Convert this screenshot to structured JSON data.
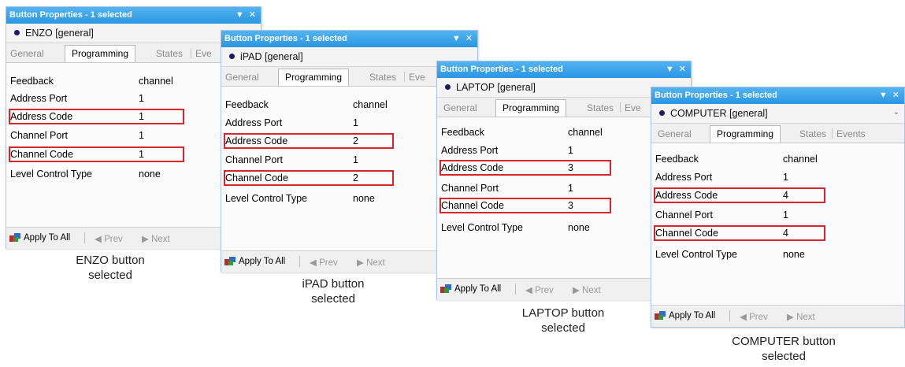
{
  "panels": [
    {
      "title": "Button Properties - 1 selected",
      "selected_label": "ENZO  [general]",
      "tabs": [
        "General",
        "Programming",
        "States",
        "Eve"
      ],
      "rows": [
        {
          "key": "Feedback",
          "value": "channel"
        },
        {
          "key": "Address Port",
          "value": "1"
        },
        {
          "key": "Address Code",
          "value": "1"
        },
        {
          "key": "Channel Port",
          "value": "1"
        },
        {
          "key": "Channel Code",
          "value": "1"
        },
        {
          "key": "Level Control Type",
          "value": "none"
        }
      ],
      "footer": {
        "apply": "Apply To All",
        "prev": "Prev",
        "next": "Next"
      },
      "caption": [
        "ENZO button",
        "selected"
      ]
    },
    {
      "title": "Button Properties - 1 selected",
      "selected_label": "iPAD  [general]",
      "tabs": [
        "General",
        "Programming",
        "States",
        "Eve"
      ],
      "rows": [
        {
          "key": "Feedback",
          "value": "channel"
        },
        {
          "key": "Address Port",
          "value": "1"
        },
        {
          "key": "Address Code",
          "value": "2"
        },
        {
          "key": "Channel Port",
          "value": "1"
        },
        {
          "key": "Channel Code",
          "value": "2"
        },
        {
          "key": "Level Control Type",
          "value": "none"
        }
      ],
      "footer": {
        "apply": "Apply To All",
        "prev": "Prev",
        "next": "Next"
      },
      "caption": [
        "iPAD button",
        "selected"
      ]
    },
    {
      "title": "Button Properties - 1 selected",
      "selected_label": "LAPTOP  [general]",
      "tabs": [
        "General",
        "Programming",
        "States",
        "Eve"
      ],
      "rows": [
        {
          "key": "Feedback",
          "value": "channel"
        },
        {
          "key": "Address Port",
          "value": "1"
        },
        {
          "key": "Address Code",
          "value": "3"
        },
        {
          "key": "Channel Port",
          "value": "1"
        },
        {
          "key": "Channel Code",
          "value": "3"
        },
        {
          "key": "Level Control Type",
          "value": "none"
        }
      ],
      "footer": {
        "apply": "Apply To All",
        "prev": "Prev",
        "next": "Next"
      },
      "caption": [
        "LAPTOP button",
        "selected"
      ]
    },
    {
      "title": "Button Properties - 1 selected",
      "selected_label": "COMPUTER  [general]",
      "tabs": [
        "General",
        "Programming",
        "States",
        "Events"
      ],
      "rows": [
        {
          "key": "Feedback",
          "value": "channel"
        },
        {
          "key": "Address Port",
          "value": "1"
        },
        {
          "key": "Address Code",
          "value": "4"
        },
        {
          "key": "Channel Port",
          "value": "1"
        },
        {
          "key": "Channel Code",
          "value": "4"
        },
        {
          "key": "Level Control Type",
          "value": "none"
        }
      ],
      "footer": {
        "apply": "Apply To All",
        "prev": "Prev",
        "next": "Next"
      },
      "caption": [
        "COMPUTER button",
        "selected"
      ]
    }
  ],
  "icons": {
    "titlebar": [
      "dropdown-arrow-icon",
      "close-icon"
    ],
    "selection": "selected-dot-icon",
    "apply": "apply-to-all-icon",
    "prev": "prev-arrow-icon",
    "next": "next-arrow-icon"
  },
  "colors": {
    "titlebar": "#2a96e3",
    "highlight_box": "#d9262c",
    "selection_dot": "#1a1a66"
  }
}
